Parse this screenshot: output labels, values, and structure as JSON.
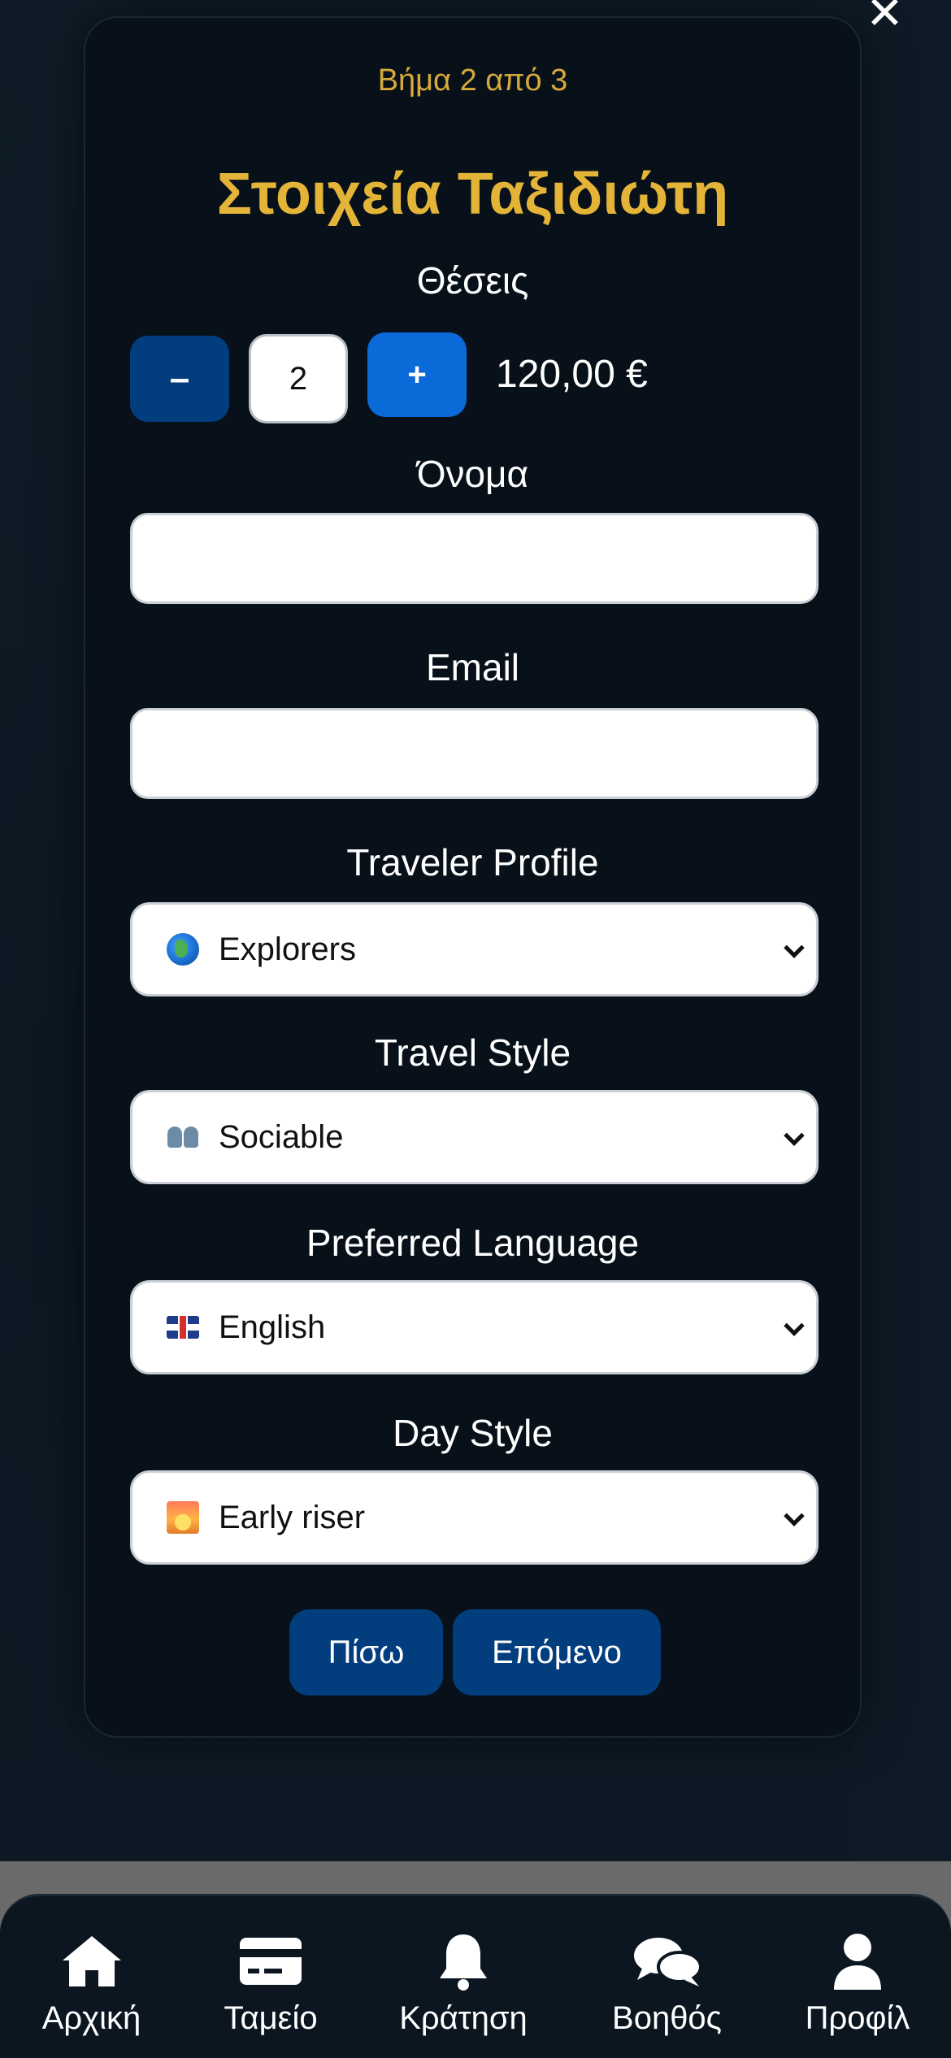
{
  "modal": {
    "close_icon": "close-icon",
    "step_text": "Βήμα 2 από 3",
    "title": "Στοιχεία Ταξιδιώτη",
    "seats": {
      "label": "Θέσεις",
      "minus_label": "–",
      "quantity": "2",
      "plus_label": "+",
      "price": "120,00 €"
    },
    "name": {
      "label": "Όνομα",
      "value": "",
      "placeholder": ""
    },
    "email": {
      "label": "Email",
      "value": "",
      "placeholder": ""
    },
    "traveler_profile": {
      "label": "Traveler Profile",
      "icon": "globe-icon",
      "selected": "Explorers"
    },
    "travel_style": {
      "label": "Travel Style",
      "icon": "people-icon",
      "selected": "Sociable"
    },
    "preferred_language": {
      "label": "Preferred Language",
      "icon": "uk-flag-icon",
      "selected": "English"
    },
    "day_style": {
      "label": "Day Style",
      "icon": "sunrise-icon",
      "selected": "Early riser"
    },
    "back_label": "Πίσω",
    "next_label": "Επόμενο"
  },
  "bottom_nav": {
    "items": [
      {
        "label": "Αρχική",
        "icon": "home-icon"
      },
      {
        "label": "Ταμείο",
        "icon": "credit-card-icon"
      },
      {
        "label": "Κράτηση",
        "icon": "bell-icon"
      },
      {
        "label": "Βοηθός",
        "icon": "chat-bubbles-icon"
      },
      {
        "label": "Προφίλ",
        "icon": "user-icon"
      }
    ]
  },
  "colors": {
    "accent_gold": "#e3b437",
    "primary_blue": "#023d7e",
    "plus_blue": "#0a6ad8",
    "modal_bg": "#08111a",
    "page_bg": "#0b1620"
  }
}
